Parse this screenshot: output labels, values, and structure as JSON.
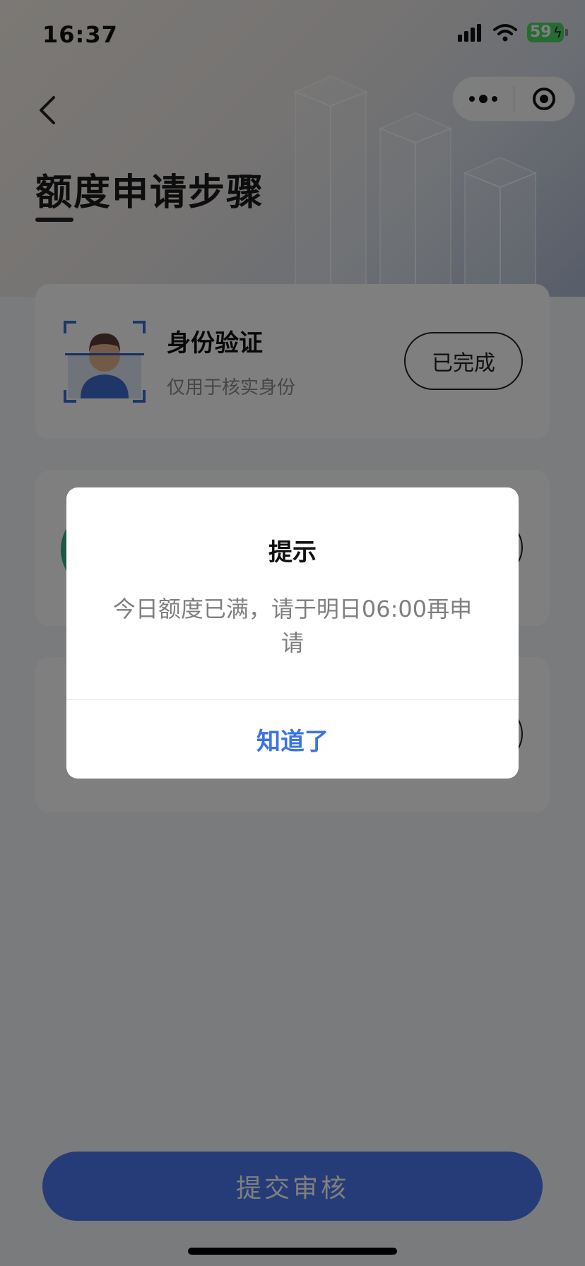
{
  "status_bar": {
    "time": "16:37",
    "battery_level": "59",
    "icons": [
      "signal-icon",
      "wifi-icon",
      "battery-icon"
    ]
  },
  "nav": {
    "back_icon": "chevron-left-icon",
    "more_icon": "more-dots-icon",
    "close_icon": "target-circle-icon"
  },
  "page": {
    "title": "额度申请步骤"
  },
  "steps": [
    {
      "title": "身份验证",
      "subtitle": "仅用于核实身份",
      "button": "已完成",
      "icon": "face-scan-icon"
    },
    {
      "title": "",
      "subtitle": "",
      "button": "",
      "icon": "green-circle-icon"
    },
    {
      "title": "",
      "subtitle": "",
      "button": "",
      "icon": ""
    }
  ],
  "submit": {
    "label": "提交审核"
  },
  "dialog": {
    "title": "提示",
    "message": "今日额度已满，请于明日06:00再申请",
    "confirm": "知道了"
  },
  "colors": {
    "primary": "#4a78f0",
    "link": "#3b73e3",
    "success": "#2fb38a",
    "overlay": "rgba(0,0,0,0.5)"
  }
}
